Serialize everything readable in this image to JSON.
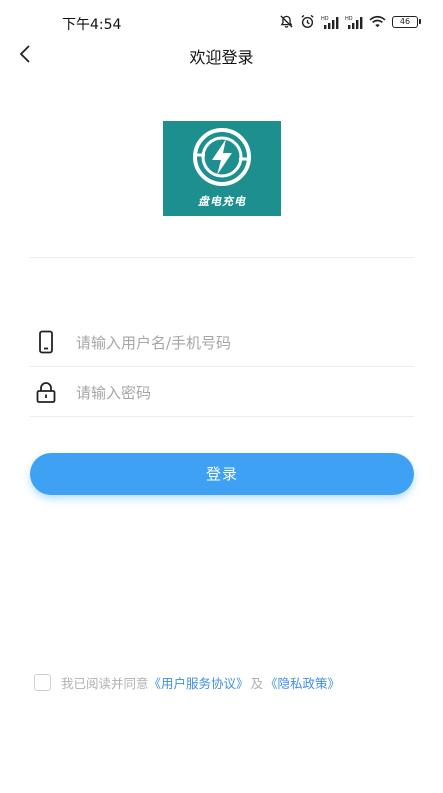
{
  "status_bar": {
    "time": "下午4:54",
    "battery": "46",
    "icons": [
      "mute-icon",
      "alarm-icon",
      "hd-signal-icon",
      "hd-signal-icon",
      "wifi-icon",
      "battery-icon"
    ]
  },
  "nav": {
    "title": "欢迎登录",
    "back_icon": "chevron-left-icon"
  },
  "logo": {
    "text": "盘电充电",
    "color": "#1e8f8f"
  },
  "form": {
    "username_placeholder": "请输入用户名/手机号码",
    "username_value": "",
    "username_icon": "phone-icon",
    "password_placeholder": "请输入密码",
    "password_value": "",
    "password_icon": "lock-icon",
    "login_label": "登录",
    "accent_color": "#3fa1f4"
  },
  "agreement": {
    "checked": false,
    "prefix": "我已阅读并同意",
    "user_agreement": "《用户服务协议》",
    "and": "及",
    "privacy_policy": "《隐私政策》"
  }
}
